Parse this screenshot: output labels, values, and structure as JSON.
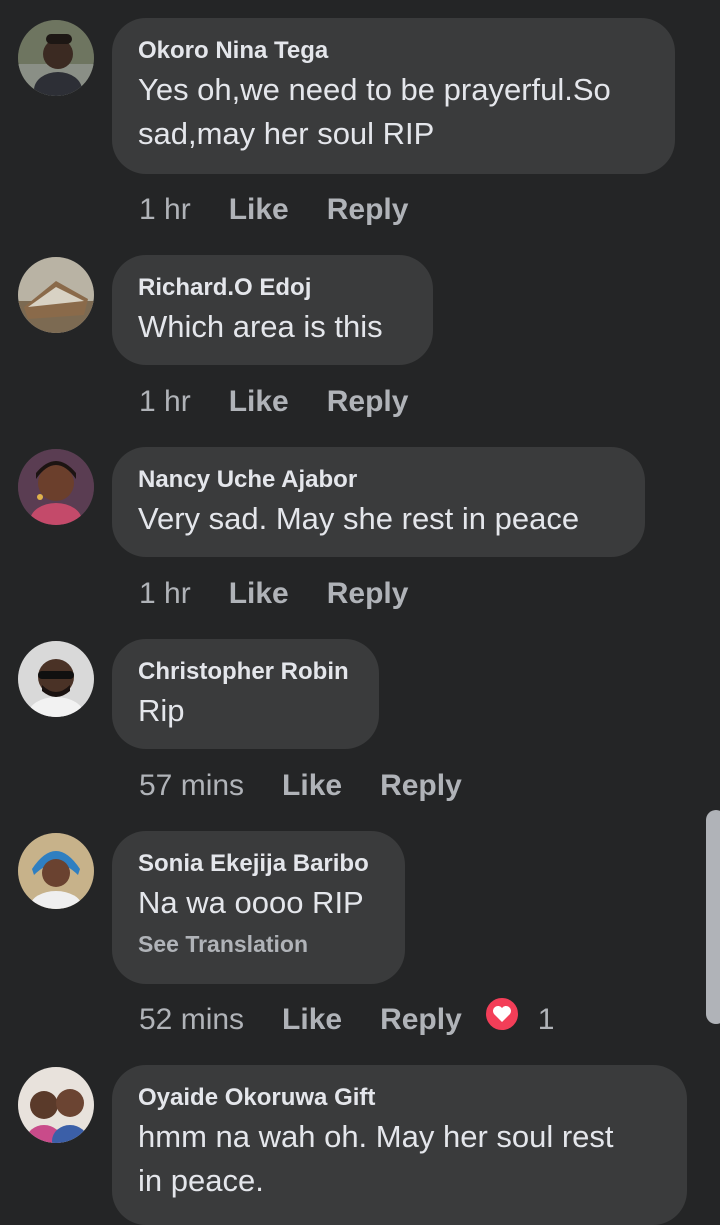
{
  "comments": [
    {
      "name": "Okoro Nina Tega",
      "text_line1": "Yes oh,we need to be prayerful.So",
      "text_line2": "sad,may her soul RIP",
      "time": "1 hr",
      "like": "Like",
      "reply": "Reply",
      "avatar_icon": "person-avatar-photo"
    },
    {
      "name": "Richard.O Edoj",
      "text_line1": "Which area is this",
      "time": "1 hr",
      "like": "Like",
      "reply": "Reply",
      "avatar_icon": "building-avatar-photo"
    },
    {
      "name": "Nancy Uche Ajabor",
      "text_line1": "Very sad. May she rest in peace",
      "time": "1 hr",
      "like": "Like",
      "reply": "Reply",
      "avatar_icon": "person-avatar-photo"
    },
    {
      "name": "Christopher Robin",
      "text_line1": "Rip",
      "time": "57 mins",
      "like": "Like",
      "reply": "Reply",
      "avatar_icon": "person-avatar-photo"
    },
    {
      "name": "Sonia Ekejija Baribo",
      "text_line1": "Na wa oooo RIP",
      "see_translation": "See Translation",
      "time": "52 mins",
      "like": "Like",
      "reply": "Reply",
      "reaction_count": "1",
      "reaction_icon": "love-reaction-icon",
      "avatar_icon": "person-avatar-photo"
    },
    {
      "name": "Oyaide Okoruwa Gift",
      "text_line1": "hmm na wah oh. May her soul rest",
      "text_line2": "in peace.",
      "avatar_icon": "person-avatar-photo"
    }
  ],
  "colors": {
    "background": "#242526",
    "bubble": "#3a3b3c",
    "primary_text": "#e4e6eb",
    "secondary_text": "#b0b3b8",
    "love_reaction": "#f33e58"
  }
}
